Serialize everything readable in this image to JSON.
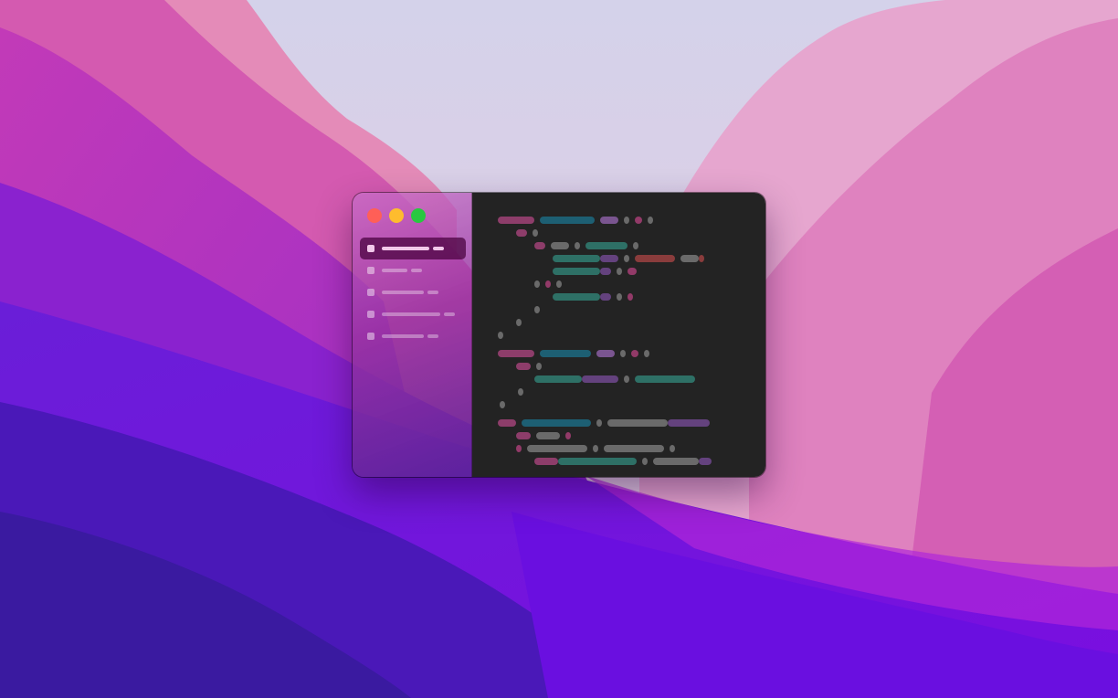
{
  "wallpaper": {
    "colors": {
      "sky": "#d9d6ea",
      "pink": "#e07ab8",
      "magenta": "#c13fc8",
      "purple": "#7a1ce0",
      "deep_violet": "#3b1aa8"
    }
  },
  "window": {
    "traffic_lights": {
      "close": {
        "icon": "close-dot",
        "color": "#ff5f57"
      },
      "minimize": {
        "icon": "minimize-dot",
        "color": "#febc2e"
      },
      "maximize": {
        "icon": "maximize-dot",
        "color": "#28c840"
      }
    },
    "sidebar": {
      "items": [
        {
          "id": "item-1",
          "active": true
        },
        {
          "id": "item-2",
          "active": false
        },
        {
          "id": "item-3",
          "active": false
        },
        {
          "id": "item-4",
          "active": false
        },
        {
          "id": "item-5",
          "active": false
        }
      ]
    },
    "editor": {
      "background": "#232323",
      "token_colors": {
        "k": "#8d3d6a",
        "c": "#1d5f73",
        "p": "#7a5590",
        "g": "#6a6a6a",
        "t": "#2e7066",
        "r": "#8a3c3c",
        "m": "#923a68",
        "v": "#64427e"
      }
    }
  }
}
